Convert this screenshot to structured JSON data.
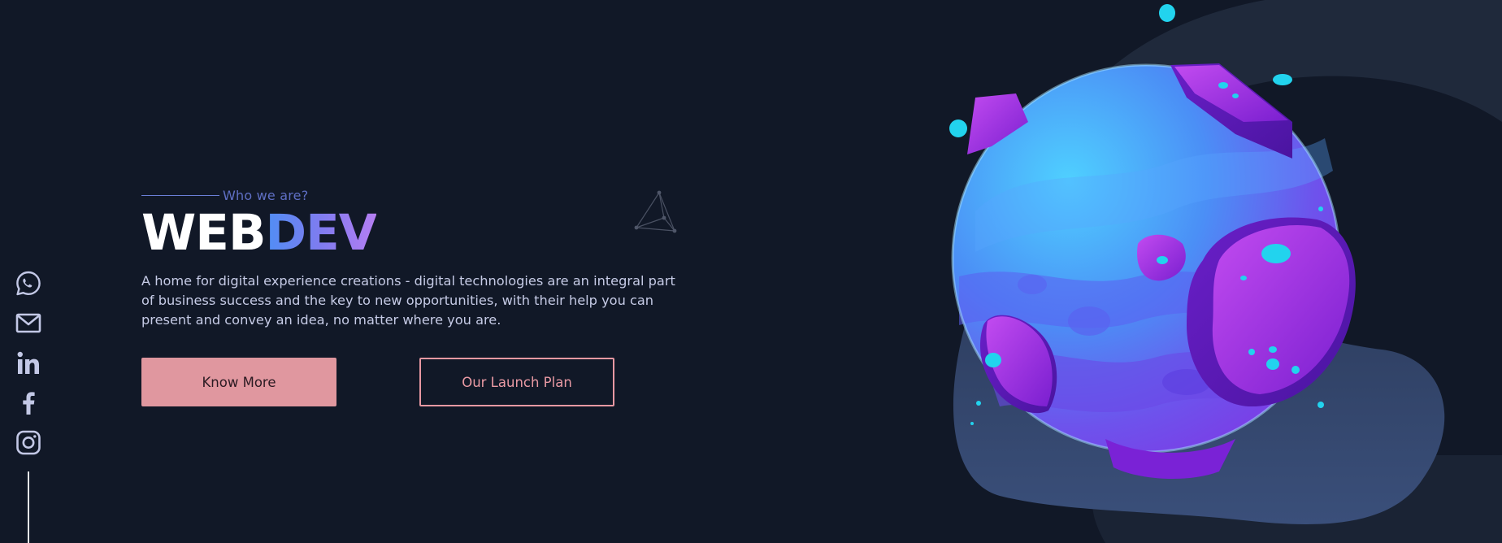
{
  "hero": {
    "eyebrow": "Who we are?",
    "title_part_a": "WEB",
    "title_part_b": "DEV",
    "description": "A home for digital experience creations - digital technologies are an integral part of business success and the key to new opportunities, with their help you can present and convey an idea, no matter where you are.",
    "primary_button": "Know More",
    "secondary_button": "Our Launch Plan"
  },
  "social": {
    "icons": [
      "whatsapp-icon",
      "mail-icon",
      "linkedin-icon",
      "facebook-icon",
      "instagram-icon"
    ]
  },
  "colors": {
    "background": "#111827",
    "primary_button": "#e0979f",
    "outline_button": "#e898a2",
    "title_gradient_start": "#4f8ef5",
    "title_gradient_end": "#b57ef2",
    "eyebrow": "#5f6fc4"
  }
}
